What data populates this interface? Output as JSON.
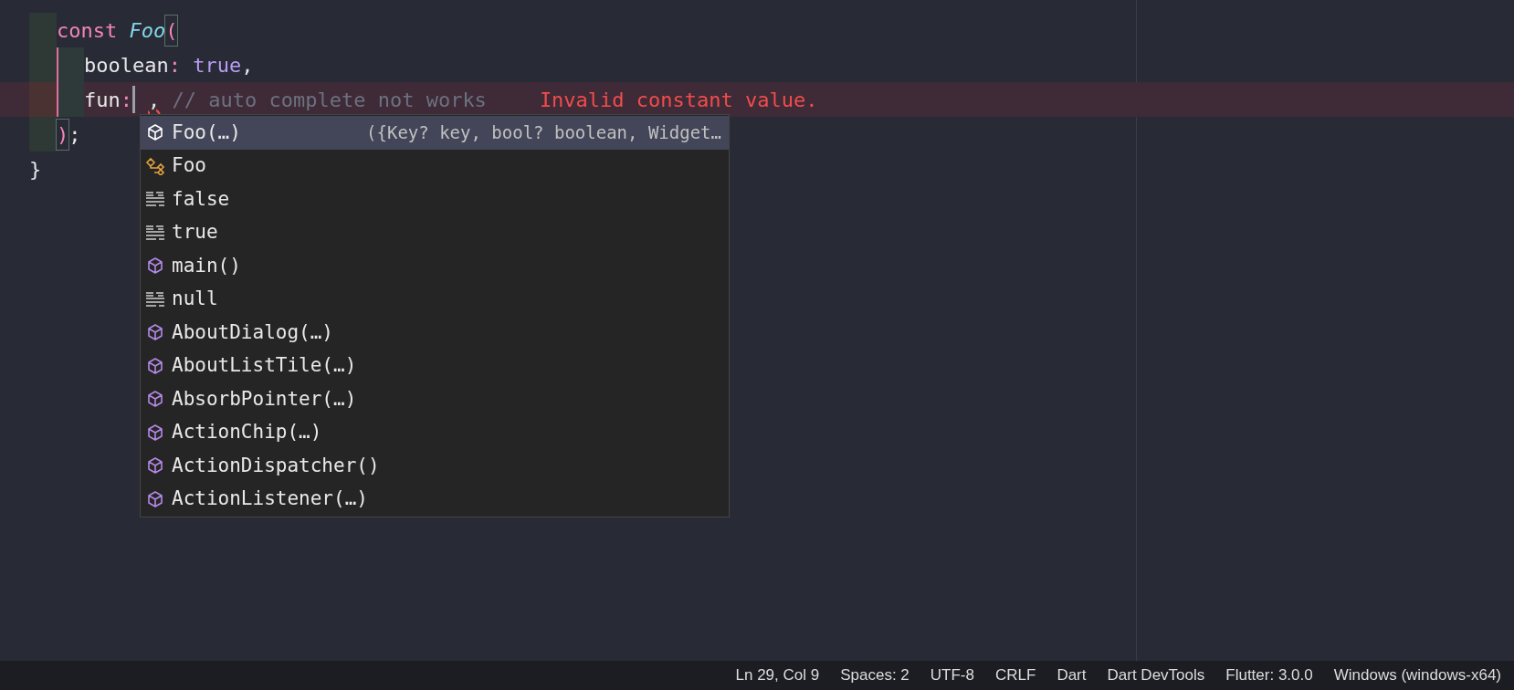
{
  "editor": {
    "lines": [
      {
        "kind": "guided",
        "error": false,
        "tokens": [
          {
            "text": "const",
            "kind": "keyword"
          },
          {
            "text": " Foo",
            "kind": "class"
          },
          {
            "text": "(",
            "kind": "bracket"
          }
        ],
        "children": [
          {
            "kind": "guided",
            "error": false,
            "tokens": [
              {
                "text": "boolean",
                "kind": "plain"
              },
              {
                "text": ":",
                "kind": "punct"
              },
              {
                "text": " true",
                "kind": "literal"
              },
              {
                "text": ",",
                "kind": "plain"
              }
            ]
          },
          {
            "kind": "guided",
            "error": true,
            "message": "Invalid constant value.",
            "tokens": [
              {
                "text": "fun",
                "kind": "plain"
              },
              {
                "text": ":",
                "kind": "punct"
              },
              {
                "kind": "cursor"
              },
              {
                "text": ",",
                "kind": "squiggle"
              },
              {
                "text": " // auto complete not works",
                "kind": "comment"
              }
            ]
          }
        ]
      },
      {
        "kind": "guided",
        "error": false,
        "tokens": [
          {
            "text": ")",
            "kind": "bracket"
          },
          {
            "text": ";",
            "kind": "plain"
          }
        ]
      },
      {
        "kind": "outer",
        "error": false,
        "tokens": [
          {
            "text": "}",
            "kind": "plain"
          }
        ]
      }
    ]
  },
  "suggestions": [
    {
      "label": "Foo(…)",
      "kind": "constructor",
      "selected": true,
      "detail": "({Key? key, bool? boolean, Widget…"
    },
    {
      "label": "Foo",
      "kind": "class",
      "selected": false
    },
    {
      "label": "false",
      "kind": "keyword",
      "selected": false
    },
    {
      "label": "true",
      "kind": "keyword",
      "selected": false
    },
    {
      "label": "main()",
      "kind": "constructor",
      "selected": false
    },
    {
      "label": "null",
      "kind": "keyword",
      "selected": false
    },
    {
      "label": "AboutDialog(…)",
      "kind": "constructor",
      "selected": false
    },
    {
      "label": "AboutListTile(…)",
      "kind": "constructor",
      "selected": false
    },
    {
      "label": "AbsorbPointer(…)",
      "kind": "constructor",
      "selected": false
    },
    {
      "label": "ActionChip(…)",
      "kind": "constructor",
      "selected": false
    },
    {
      "label": "ActionDispatcher()",
      "kind": "constructor",
      "selected": false
    },
    {
      "label": "ActionListener(…)",
      "kind": "constructor",
      "selected": false
    }
  ],
  "status_bar": [
    "Ln 29, Col 9",
    "Spaces: 2",
    "UTF-8",
    "CRLF",
    "Dart",
    "Dart DevTools",
    "Flutter: 3.0.0",
    "Windows (windows-x64)"
  ]
}
